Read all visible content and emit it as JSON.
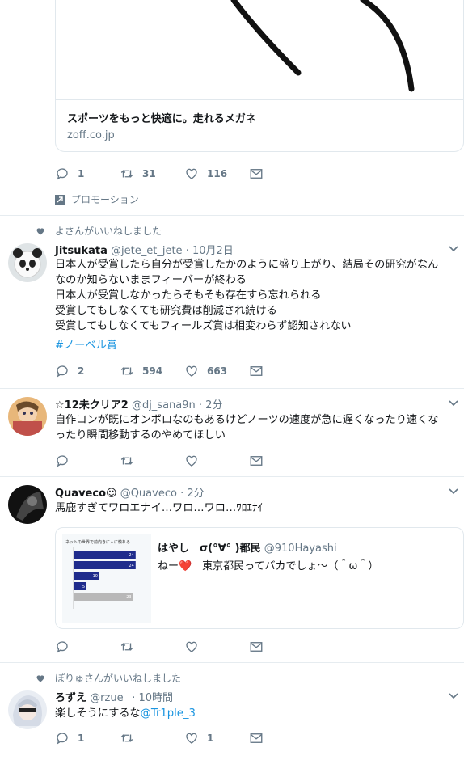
{
  "ad": {
    "card_title": "スポーツをもっと快適に。走れるメガネ",
    "card_domain": "zoff.co.jp",
    "replies": "1",
    "retweets": "31",
    "likes": "116",
    "promo_label": "プロモーション"
  },
  "tweets": [
    {
      "social": "よさんがいいねしました",
      "name": "Jitsukata",
      "handle": "@jete_et_jete",
      "time": "· 10月2日",
      "text": "日本人が受賞したら自分が受賞したかのように盛り上がり、結局その研究がなん\nなのか知らないままフィーバーが終わる\n日本人が受賞しなかったらそもそも存在すら忘れられる\n受賞してもしなくても研究費は削減され続ける\n受賞してもしなくてもフィールズ賞は相変わらず認知されない",
      "hashtag": "#ノーベル賞",
      "replies": "2",
      "retweets": "594",
      "likes": "663"
    },
    {
      "name": "☆12未クリア2",
      "handle": "@dj_sana9n",
      "time": "· 2分",
      "text": "自作コンが既にオンボロなのもあるけどノーツの速度が急に遅くなったり速くな\nったり瞬間移動するのやめてほしい"
    },
    {
      "name": "Quaveco☺",
      "handle": "@Quaveco",
      "time": "· 2分",
      "text": "馬鹿すぎてワロエナイ…ワロ…ワロ…ﾜﾛｴﾅｲ",
      "quote": {
        "name": "はやし　σ(°∀°  )都民",
        "handle": "@910Hayashi",
        "text": "ねー❤️　東京都民ってバカでしょ～（＾ω＾）"
      }
    },
    {
      "social": "ぽりゅさんがいいねしました",
      "name": "ろずえ",
      "handle": "@rzue_",
      "time": "· 10時間",
      "text": "楽しそうにするな",
      "mention": "@Tr1ple_3",
      "replies": "1",
      "likes": "1"
    }
  ],
  "quote_chart": {
    "title": "ネットの世界で前向きに人に触れる",
    "values": [
      24,
      24,
      10,
      5,
      23
    ]
  },
  "colors": {
    "accent": "#1b95e0",
    "muted": "#657786",
    "border": "#e6ecf0"
  }
}
